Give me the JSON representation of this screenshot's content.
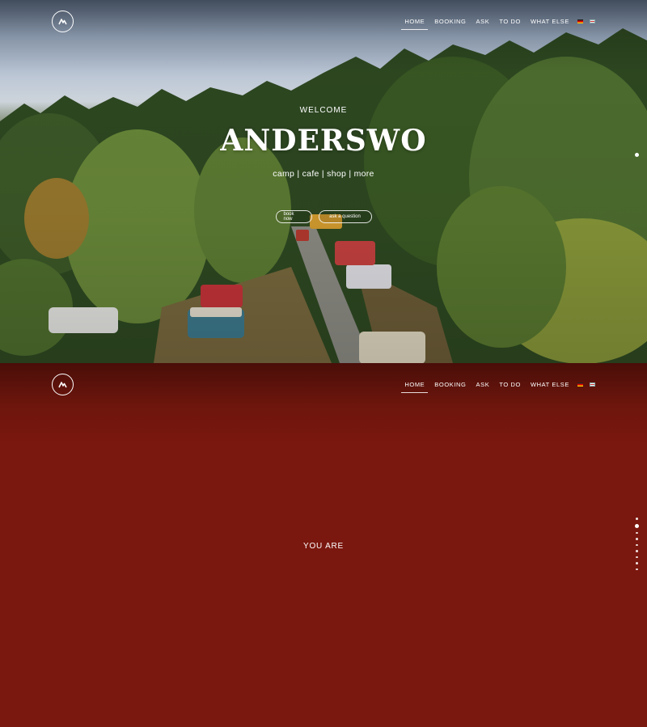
{
  "nav": {
    "items": [
      {
        "label": "HOME",
        "active": true
      },
      {
        "label": "BOOKING",
        "active": false
      },
      {
        "label": "ASK",
        "active": false
      },
      {
        "label": "TO DO",
        "active": false
      },
      {
        "label": "WHAT ELSE",
        "active": false
      }
    ],
    "languages": [
      "de",
      "en"
    ]
  },
  "hero": {
    "welcome": "WELCOME",
    "title": "ANDERSWO",
    "subtitle": "camp | cafe | shop | more",
    "book_label": "book now",
    "ask_label": "ask a question",
    "background_icon": "aerial-campsite-photo"
  },
  "section2": {
    "heading": "YOU ARE",
    "background_color": "#7a170e"
  },
  "page_dots": {
    "count": 9,
    "active_index": 1
  }
}
